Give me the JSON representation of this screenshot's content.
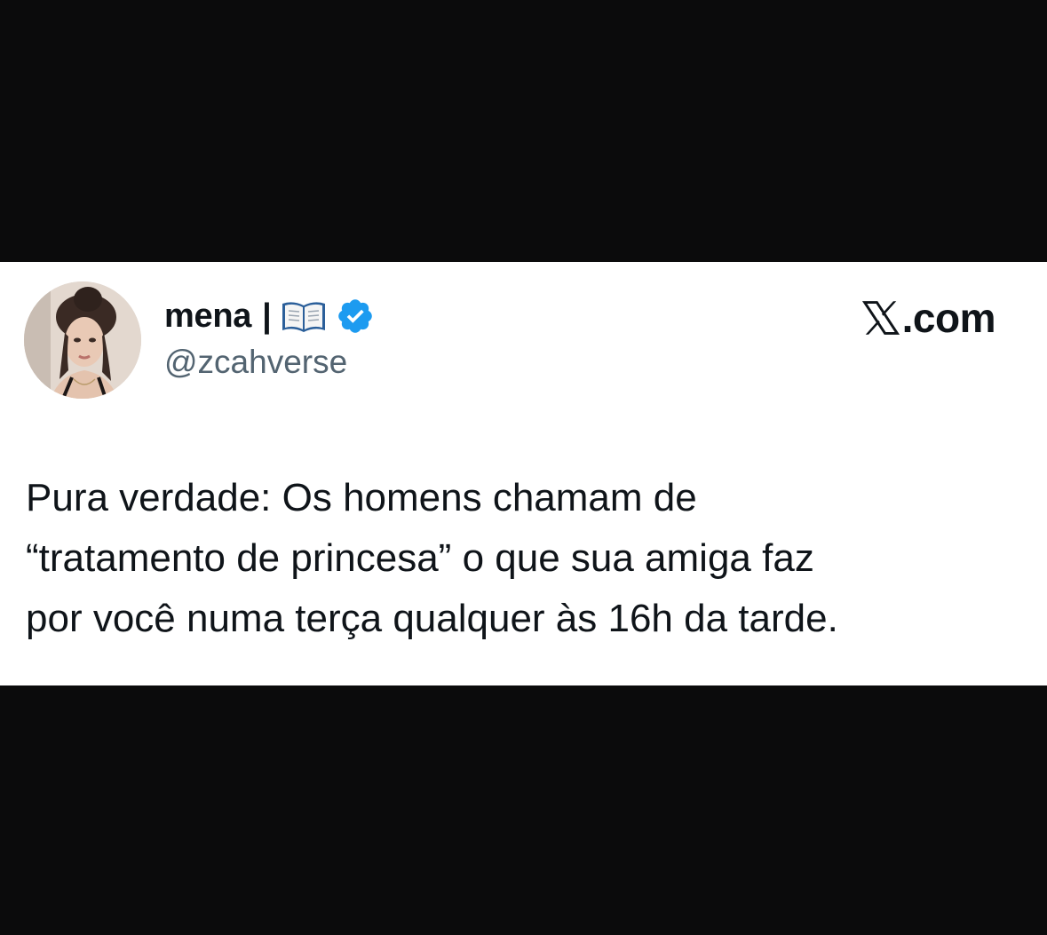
{
  "tweet": {
    "author": {
      "display_name": "mena",
      "separator": "|",
      "name_icon": "open-book-icon",
      "verified_icon": "verified-badge-icon",
      "handle": "@zcahverse"
    },
    "site": {
      "logo_icon": "x-logo-icon",
      "label": ".com"
    },
    "text_lines": [
      "Pura verdade: Os homens chamam de",
      "“tratamento de princesa” o que sua amiga faz",
      "por você numa terça qualquer às 16h da tarde."
    ]
  },
  "colors": {
    "background": "#0b0b0c",
    "card": "#ffffff",
    "text": "#0f1419",
    "secondary_text": "#536471",
    "verified": "#1d9bf0"
  }
}
